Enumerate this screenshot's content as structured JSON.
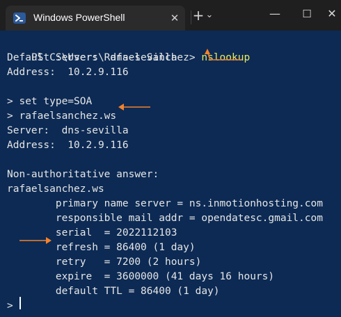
{
  "window": {
    "tab_title": "Windows PowerShell",
    "tab_close": "✕",
    "new_tab": "+",
    "dropdown": "⌄",
    "minimize": "—",
    "maximize": "☐",
    "close": "✕"
  },
  "terminal": {
    "prompt": "PS C:\\Users\\Rafael Sanchez>",
    "command": "nslookup",
    "lines": [
      "Default Server:  dns-sevilla",
      "Address:  10.2.9.116",
      "",
      "> set type=SOA",
      "> rafaelsanchez.ws",
      "Server:  dns-sevilla",
      "Address:  10.2.9.116",
      "",
      "Non-authoritative answer:",
      "rafaelsanchez.ws",
      "        primary name server = ns.inmotionhosting.com",
      "        responsible mail addr = opendatesc.gmail.com",
      "        serial  = 2022112103",
      "        refresh = 86400 (1 day)",
      "        retry   = 7200 (2 hours)",
      "        expire  = 3600000 (41 days 16 hours)",
      "        default TTL = 86400 (1 day)",
      "",
      ">"
    ]
  },
  "colors": {
    "background": "#0c2a54",
    "text": "#e6e6e6",
    "command": "#e7ed62",
    "annotation_arrow": "#f5822a"
  },
  "annotations": [
    "arrow-up",
    "arrow-left",
    "arrow-right"
  ]
}
